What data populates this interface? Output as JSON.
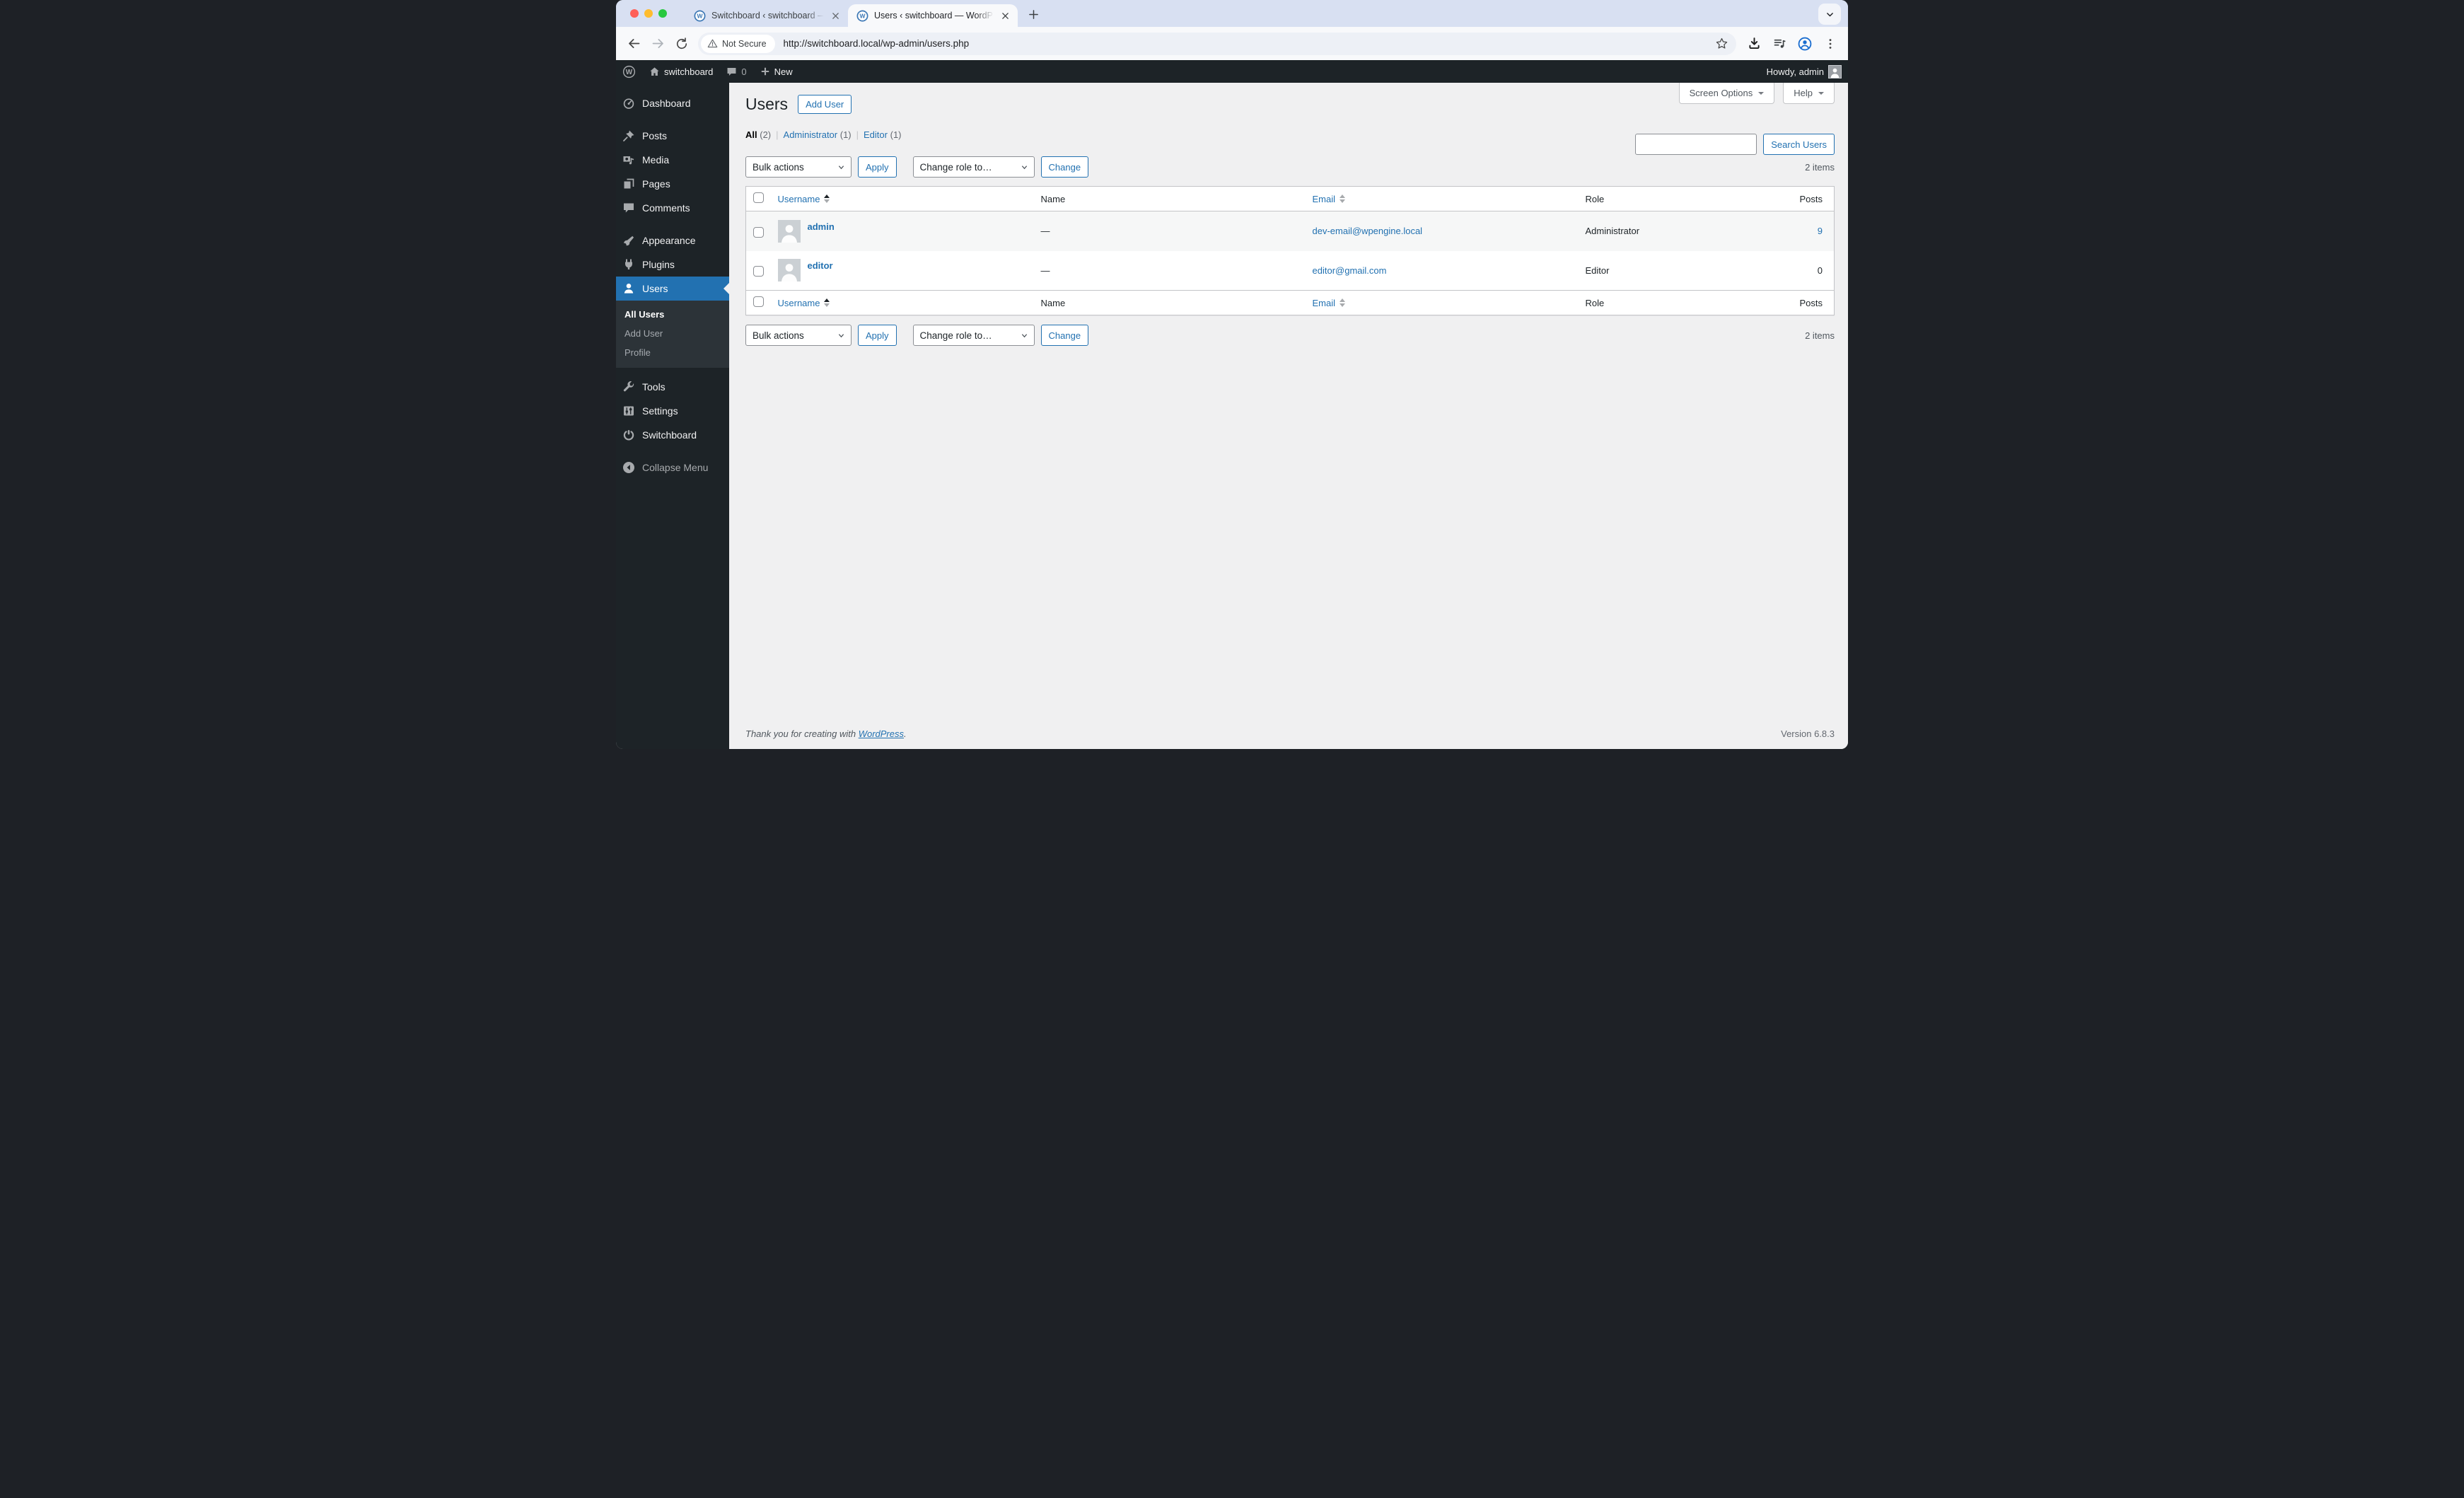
{
  "browser": {
    "tabs": [
      {
        "title": "Switchboard ‹ switchboard —"
      },
      {
        "title": "Users ‹ switchboard — WordP"
      }
    ],
    "not_secure_label": "Not Secure",
    "url": "http://switchboard.local/wp-admin/users.php"
  },
  "admin_bar": {
    "site_name": "switchboard",
    "comments_count": "0",
    "new_label": "New",
    "howdy": "Howdy, admin"
  },
  "sidebar": {
    "items": [
      {
        "label": "Dashboard"
      },
      {
        "label": "Posts"
      },
      {
        "label": "Media"
      },
      {
        "label": "Pages"
      },
      {
        "label": "Comments"
      },
      {
        "label": "Appearance"
      },
      {
        "label": "Plugins"
      },
      {
        "label": "Users"
      },
      {
        "label": "Tools"
      },
      {
        "label": "Settings"
      },
      {
        "label": "Switchboard"
      },
      {
        "label": "Collapse Menu"
      }
    ],
    "users_submenu": [
      {
        "label": "All Users"
      },
      {
        "label": "Add User"
      },
      {
        "label": "Profile"
      }
    ]
  },
  "meta": {
    "screen_options": "Screen Options",
    "help": "Help"
  },
  "main": {
    "title": "Users",
    "add_user_label": "Add User",
    "views": {
      "all": "All",
      "all_count": "(2)",
      "admin": "Administrator",
      "admin_count": "(1)",
      "editor": "Editor",
      "editor_count": "(1)",
      "separator": "|"
    },
    "search_button": "Search Users",
    "bulk": {
      "bulk_actions": "Bulk actions",
      "apply": "Apply",
      "change_role": "Change role to…",
      "change": "Change",
      "items_count": "2 items"
    },
    "table": {
      "columns": {
        "username": "Username",
        "name": "Name",
        "email": "Email",
        "role": "Role",
        "posts": "Posts"
      },
      "rows": [
        {
          "username": "admin",
          "name": "—",
          "email": "dev-email@wpengine.local",
          "role": "Administrator",
          "posts": "9"
        },
        {
          "username": "editor",
          "name": "—",
          "email": "editor@gmail.com",
          "role": "Editor",
          "posts": "0"
        }
      ]
    },
    "footer": {
      "thanks_prefix": "Thank you for creating with ",
      "wordpress_link": "WordPress",
      "thanks_suffix": ".",
      "version": "Version 6.8.3"
    }
  },
  "colors": {
    "accent": "#2271b1",
    "admin_dark": "#1d2327",
    "content_bg": "#f0f0f1"
  }
}
